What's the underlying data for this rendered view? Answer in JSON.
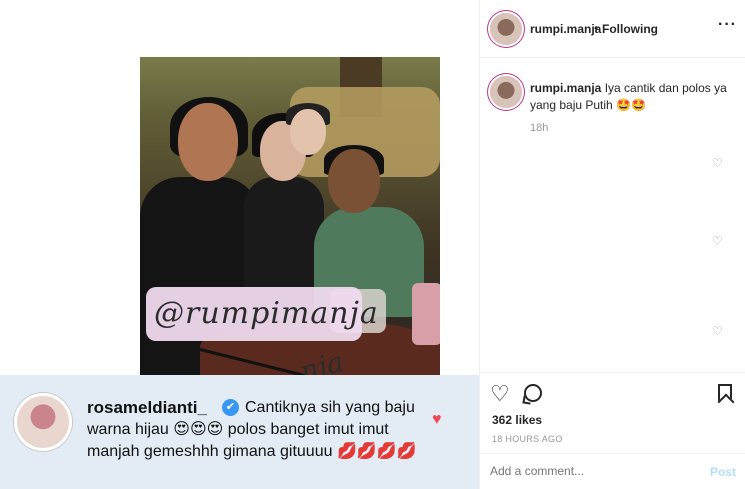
{
  "post": {
    "username": "rumpi.manja",
    "follow_status": "Following",
    "separator": "•",
    "more_icon": "more-horizontal-icon"
  },
  "caption": {
    "username": "rumpi.manja",
    "text": "Iya cantik dan polos ya yang baju Putih 🤩🤩",
    "time": "18h"
  },
  "photo": {
    "watermark": "@rumpimanja",
    "watermark_tail": "nja"
  },
  "embedded_comment": {
    "username": "rosameldianti_",
    "verified_icon": "✔",
    "text": "Cantiknya sih yang baju warna hijau 😍😍😍 polos banget imut imut manjah gemeshhh gimana gituuuu 💋💋💋💋",
    "heart_color": "#ed4956"
  },
  "actions": {
    "likes": "362 likes",
    "post_time": "18 HOURS AGO",
    "add_comment_placeholder": "Add a comment...",
    "post_label": "Post"
  },
  "colors": {
    "accent": "#3897f0",
    "post_disabled": "#b2dffc",
    "comment_bg": "#e3ecf4"
  }
}
